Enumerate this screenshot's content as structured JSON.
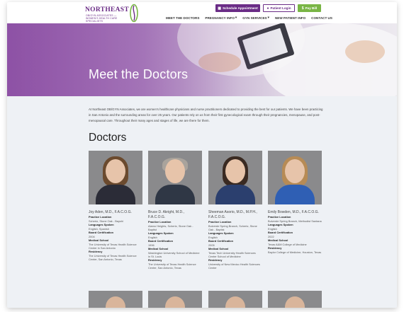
{
  "header": {
    "logo_title": "NORTHEAST",
    "logo_subtitle": "OB/GYN ASSOCIATES — WOMEN'S HEALTH CARE SPECIALISTS",
    "buttons": {
      "schedule": "Schedule Appointment",
      "portal": "Patient Login",
      "pay": "Pay Bill"
    },
    "nav": [
      {
        "label": "MEET THE DOCTORS",
        "caret": false
      },
      {
        "label": "PREGNANCY INFO",
        "caret": true
      },
      {
        "label": "GYN SERVICES",
        "caret": true
      },
      {
        "label": "NEW PATIENT INFO",
        "caret": false
      },
      {
        "label": "CONTACT US",
        "caret": false
      }
    ],
    "caret_glyph": "▾"
  },
  "hero": {
    "title": "Meet the Doctors"
  },
  "intro": "At Northeast OB/GYN Associates, we are women's healthcare physicians and nurse practitioners dedicated to providing the best for our patients. We have been practicing in San Antonio and the surrounding areas for over 25 years. Our patients rely on us from their first gynecological exam through their pregnancies, menopause, and post-menopausal care. Throughout their many ages and stages of life, we are there for them.",
  "section_title": "Doctors",
  "labels": {
    "practice": "Practice Location",
    "languages": "Languages Spoken",
    "board": "Board Certification",
    "school": "Medical School",
    "residency": "Residency"
  },
  "doctors": [
    {
      "name": "Joy Aden, M.D., F.A.C.O.G.",
      "practice": "Schertz, Stone Oak - Bayshi",
      "languages": "English, Spanish",
      "board": "2004",
      "school": "The University of Texas Health Science Center in San Antonio",
      "residency": "The University of Texas Health Science Center, San Antonio, Texas"
    },
    {
      "name": "Bruce D. Akright, M.D., F.A.C.O.G.",
      "practice": "Alamo Heights, Schertz, Stone Oak - Baptist",
      "languages": "English",
      "board": "1996",
      "school": "Washington University School of Medicine in St. Louis",
      "residency": "The University of Texas Health Science Center, San Antonio, Texas"
    },
    {
      "name": "Sheeman Asorio, M.D., M.P.H., F.A.C.O.G.",
      "practice": "Bulverde Spring Branch, Schertz, Stone Oak - Baptist",
      "languages": "English",
      "board": "2005",
      "school": "Texas Tech University Health Sciences Center School of Medicine",
      "residency": "University of New Mexico Health Sciences Center"
    },
    {
      "name": "Emily Bowden, M.D., F.A.C.O.G.",
      "practice": "Bulverde Spring Branch, Methodist Santana",
      "languages": "English",
      "board": "2022",
      "school": "Texas A&M College of Medicine",
      "residency": "Baylor College of Medicine, Houston, Texas"
    }
  ],
  "colors": {
    "brand_purple": "#6a2c86",
    "pay_green": "#79b545"
  }
}
